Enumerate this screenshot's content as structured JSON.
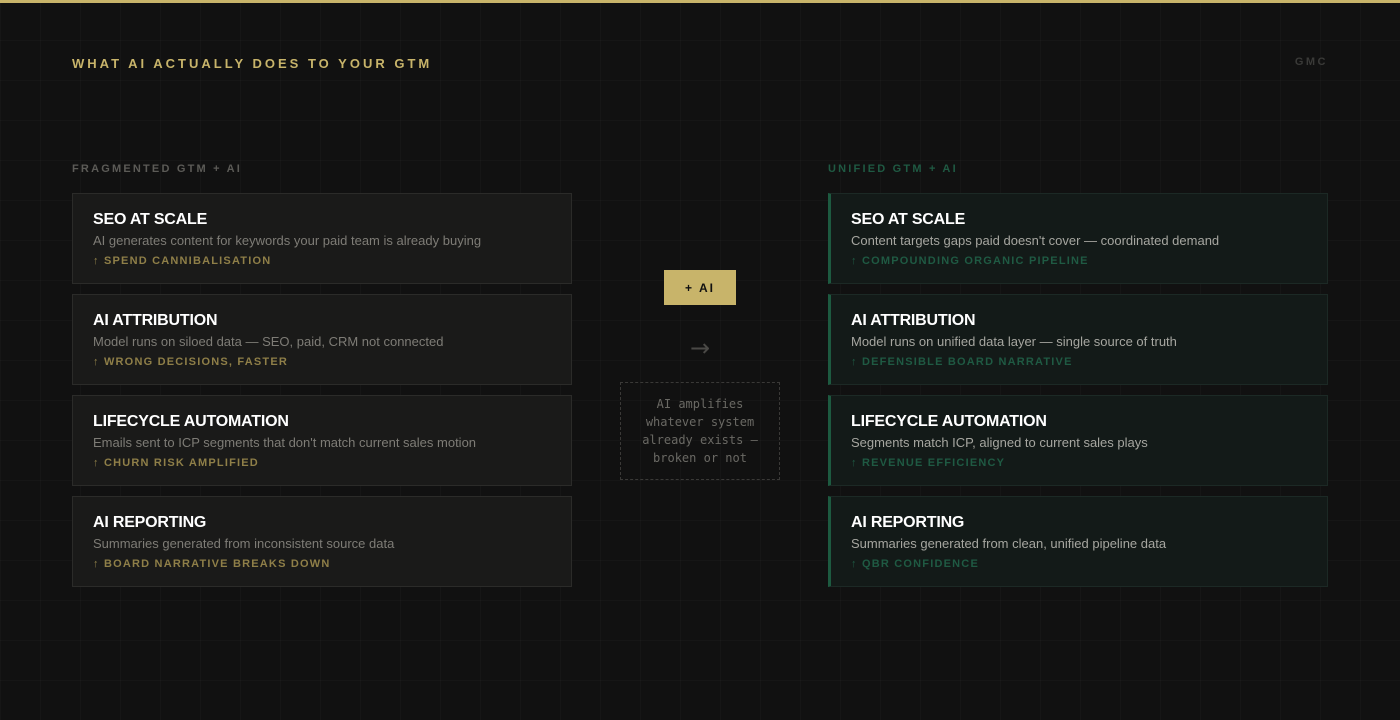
{
  "header": {
    "title": "WHAT AI ACTUALLY DOES TO YOUR GTM",
    "brand": "GMC"
  },
  "colors": {
    "accent_gold": "#c8b46a",
    "accent_green": "#1d5a40",
    "background": "#111111"
  },
  "left": {
    "label": "FRAGMENTED GTM + AI",
    "cards": [
      {
        "title": "SEO AT SCALE",
        "desc": "AI generates content for keywords your paid team is already buying",
        "tag": "↑ SPEND CANNIBALISATION"
      },
      {
        "title": "AI ATTRIBUTION",
        "desc": "Model runs on siloed data — SEO, paid, CRM not connected",
        "tag": "↑ WRONG DECISIONS, FASTER"
      },
      {
        "title": "LIFECYCLE AUTOMATION",
        "desc": "Emails sent to ICP segments that don't match current sales motion",
        "tag": "↑ CHURN RISK AMPLIFIED"
      },
      {
        "title": "AI REPORTING",
        "desc": "Summaries generated from inconsistent source data",
        "tag": "↑ BOARD NARRATIVE BREAKS DOWN"
      }
    ]
  },
  "center": {
    "badge": "+ AI",
    "arrow": "→",
    "arrow_icon": "arrow-right-icon",
    "note": "AI amplifies whatever system already exists — broken or not"
  },
  "right": {
    "label": "UNIFIED GTM + AI",
    "cards": [
      {
        "title": "SEO AT SCALE",
        "desc": "Content targets gaps paid doesn't cover — coordinated demand",
        "tag": "↑ COMPOUNDING ORGANIC PIPELINE"
      },
      {
        "title": "AI ATTRIBUTION",
        "desc": "Model runs on unified data layer — single source of truth",
        "tag": "↑ DEFENSIBLE BOARD NARRATIVE"
      },
      {
        "title": "LIFECYCLE AUTOMATION",
        "desc": "Segments match ICP, aligned to current sales plays",
        "tag": "↑ REVENUE EFFICIENCY"
      },
      {
        "title": "AI REPORTING",
        "desc": "Summaries generated from clean, unified pipeline data",
        "tag": "↑ QBR CONFIDENCE"
      }
    ]
  }
}
